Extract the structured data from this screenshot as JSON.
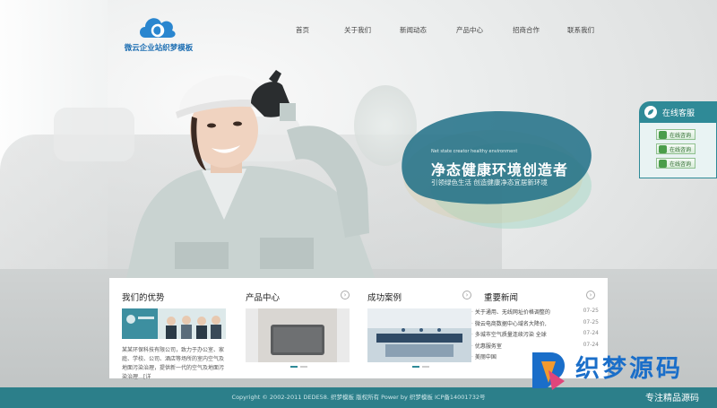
{
  "logo": {
    "text": "微云企业站织梦模板"
  },
  "nav": {
    "items": [
      "首页",
      "关于我们",
      "新闻动态",
      "产品中心",
      "招商合作",
      "联系我们"
    ]
  },
  "banner": {
    "slogan_en": "Net state creator healthy environment",
    "slogan_main": "净态健康环境创造者",
    "slogan_sub": "引领绿色生活   创造健康净态宜居新环境"
  },
  "service": {
    "title": "在线客服",
    "buttons": [
      "在线咨询",
      "在线咨询",
      "在线咨询"
    ]
  },
  "sections": {
    "advantage": {
      "title": "我们的优势",
      "text": "某某环保科技有限公司，致力于办公室、家庭、学校、公司、酒店等场所的室内空气及地面污染治理，提供新一代的空气及地面污染治理…[详"
    },
    "products": {
      "title": "产品中心",
      "more": "›"
    },
    "cases": {
      "title": "成功案例",
      "more": "›"
    },
    "news": {
      "title": "重要新闻",
      "more": "›",
      "items": [
        {
          "title": "关于通用、无线网址价格调整的",
          "date": "07-25"
        },
        {
          "title": "微云电商数据中心域名大降价,",
          "date": "07-25"
        },
        {
          "title": "多城市空气质量连续污染 全球",
          "date": "07-24"
        },
        {
          "title": "优惠服务室",
          "date": "07-24"
        },
        {
          "title": "美丽中国",
          "date": ""
        }
      ]
    }
  },
  "footer": {
    "text": "Copyright © 2002-2011 DEDE58. 织梦模板 版权所有 Power by 织梦模板 ICP备14001732号"
  },
  "watermark": {
    "title": "织梦源码",
    "subtitle": "专注精品源码"
  },
  "colors": {
    "brand": "#1e6fb3",
    "teal": "#2f8a97",
    "footer": "#2c7f8a"
  }
}
